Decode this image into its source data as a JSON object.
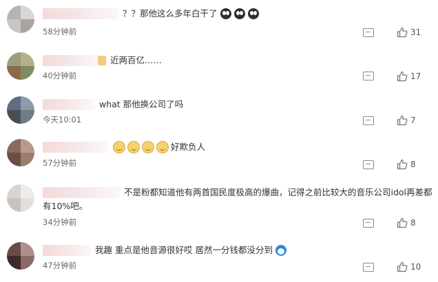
{
  "colors": {
    "text": "#333333",
    "meta": "#666666",
    "icon": "#888888"
  },
  "icons": {
    "reply": "comment-icon",
    "like": "thumbs-up-icon",
    "emoji_sad": "crying-face-emoji",
    "emoji_smile": "laughing-face-emoji",
    "emoji_dora": "doraemon-emoji"
  },
  "comments": [
    {
      "username": "",
      "text": "？？那他这么多年白干了",
      "time": "58分钟前",
      "likes": "31"
    },
    {
      "username": "",
      "text": "近两百亿……",
      "time": "40分钟前",
      "likes": "17"
    },
    {
      "username": "",
      "text": "what 那他换公司了吗",
      "time": "今天10:01",
      "likes": "7"
    },
    {
      "username": "",
      "text": "好欺负人",
      "time": "57分钟前",
      "likes": "8"
    },
    {
      "username": "",
      "text": "不是粉都知道他有两首国民度极高的爆曲，记得之前比较大的音乐公司idol再差都",
      "text2": "有10%吧。",
      "time": "34分钟前",
      "likes": "8"
    },
    {
      "username": "",
      "text": "我趣 重点是他音源很好哎 居然一分钱都没分到",
      "time": "47分钟前",
      "likes": "10"
    }
  ]
}
